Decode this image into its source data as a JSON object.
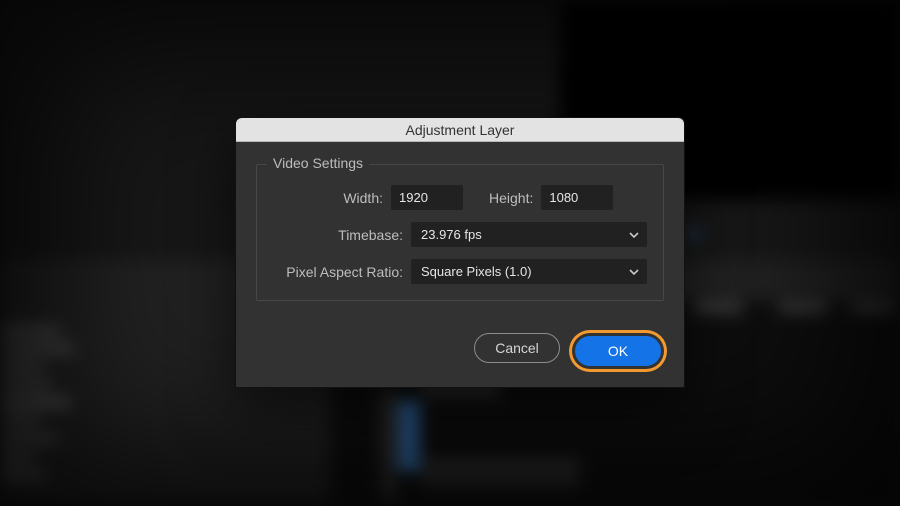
{
  "dialog": {
    "title": "Adjustment Layer",
    "group_legend": "Video Settings",
    "width_label": "Width:",
    "height_label": "Height:",
    "timebase_label": "Timebase:",
    "par_label": "Pixel Aspect Ratio:",
    "cancel_label": "Cancel",
    "ok_label": "OK"
  },
  "values": {
    "width": "1920",
    "height": "1080",
    "timebase": "23.976 fps",
    "pixel_aspect_ratio": "Square Pixels (1.0)"
  },
  "colors": {
    "accent": "#1473e6",
    "highlight_ring": "#f29a30",
    "dialog_bg": "#323232"
  }
}
